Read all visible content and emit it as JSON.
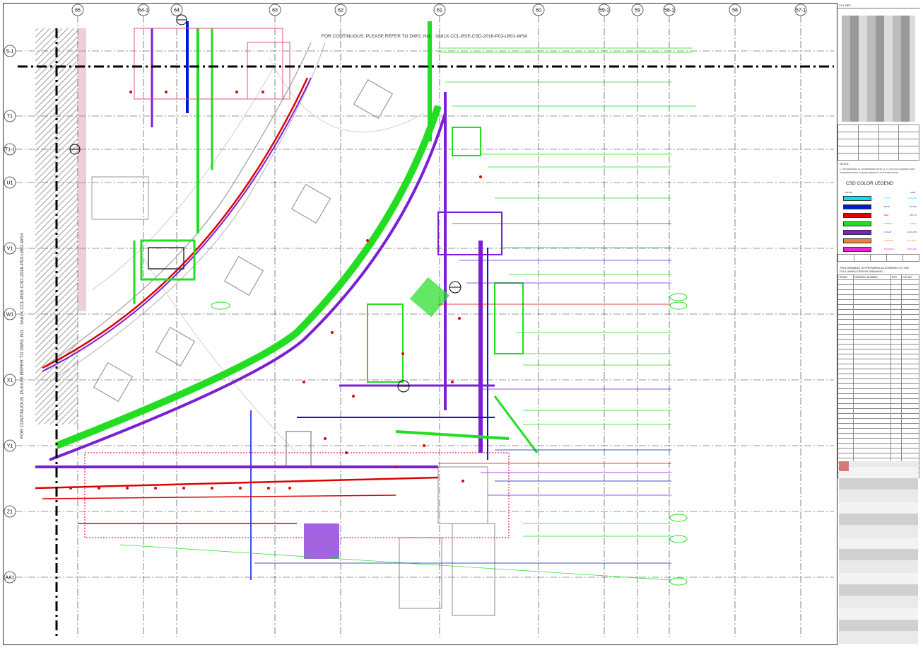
{
  "grid": {
    "columns": [
      {
        "label": "65",
        "pos": 110
      },
      {
        "label": "64-1",
        "pos": 203
      },
      {
        "label": "64",
        "pos": 250
      },
      {
        "label": "63",
        "pos": 389
      },
      {
        "label": "62",
        "pos": 482
      },
      {
        "label": "61",
        "pos": 622
      },
      {
        "label": "60",
        "pos": 762
      },
      {
        "label": "59-1",
        "pos": 855
      },
      {
        "label": "59",
        "pos": 902
      },
      {
        "label": "58-1",
        "pos": 947
      },
      {
        "label": "58",
        "pos": 1040
      },
      {
        "label": "57-1",
        "pos": 1133
      }
    ],
    "rows": [
      {
        "label": "S-1",
        "pos": 72
      },
      {
        "label": "T1",
        "pos": 164
      },
      {
        "label": "T1-1",
        "pos": 211
      },
      {
        "label": "U1",
        "pos": 258
      },
      {
        "label": "V1",
        "pos": 351
      },
      {
        "label": "W1",
        "pos": 444
      },
      {
        "label": "X1",
        "pos": 537
      },
      {
        "label": "Y1",
        "pos": 630
      },
      {
        "label": "Z1",
        "pos": 723
      },
      {
        "label": "AA1",
        "pos": 816
      }
    ]
  },
  "notes": {
    "top": "FOR CONTINUOUS, PLEASE REFER TO DWG. NO. : 3A61X-CCL-BSE-CSD-2016-P03-LB01-WS4",
    "left": "FOR CONTINUOUS, PLEASE REFER TO DWG. NO. : 3A61X-CCL-BSE-CSD-2016-P03-LB01-WS4"
  },
  "title_block": {
    "header": "CCL REF",
    "notes_title": "NOTES:",
    "notes_text": "1. THIS DRAWING IS COORDINATED WITH L1. 2. FOR ALL FLASHINGS AND WATERPROOFING, PLEASE REFER TO PLATFORM DETAIL.",
    "legend_title": "CSD COLOR LEGEND",
    "legend_head_left": "COLOR",
    "legend_head_right": "RGB",
    "legend": [
      {
        "color": "#00e5ee",
        "code": "CYAN",
        "rgb": "0,255,255"
      },
      {
        "color": "#0016d9",
        "code": "BLUE",
        "rgb": "0,0,255"
      },
      {
        "color": "#e00000",
        "code": "RED",
        "rgb": "255,0,0"
      },
      {
        "color": "#22dd22",
        "code": "GREEN",
        "rgb": "0,255,0"
      },
      {
        "color": "#7a1fd6",
        "code": "VIOLET",
        "rgb": "128,0,255"
      },
      {
        "color": "#f08040",
        "code": "ORANGE",
        "rgb": "255,128,0"
      },
      {
        "color": "#ee22dd",
        "code": "MAGENTA",
        "rgb": "255,0,255"
      }
    ],
    "prepared": "THIS DRAWING IS PREPARED ACCORDING TO THE FOLLOWING DESIGN DRAWING :-",
    "drawing_table_header": [
      "TRADE",
      "DRAWING NUMBER",
      "REV",
      "CAT NO."
    ]
  },
  "colors": {
    "cyan": "#00e5ee",
    "blue": "#0016d9",
    "red": "#e00000",
    "green": "#22dd22",
    "violet": "#7a1fd6",
    "magenta": "#ee22dd",
    "pink": "#e05080",
    "grey": "#9a9a9a"
  }
}
